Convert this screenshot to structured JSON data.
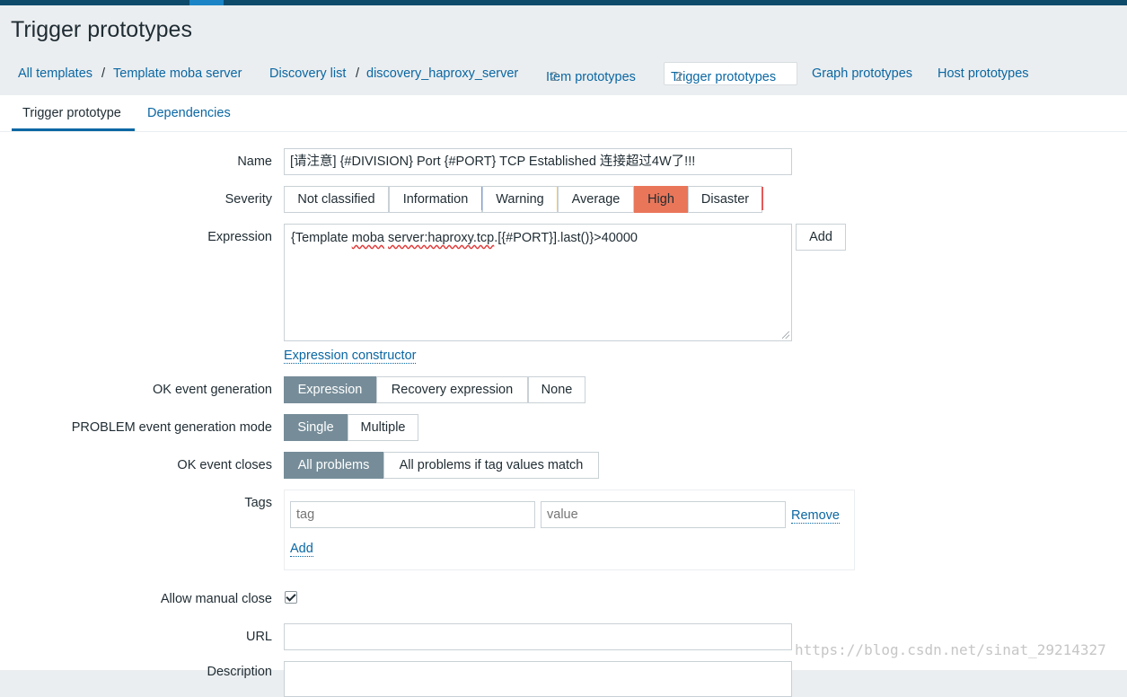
{
  "page": {
    "title": "Trigger prototypes"
  },
  "breadcrumbs": {
    "all_templates": "All templates",
    "template": "Template moba server",
    "discovery_list": "Discovery list",
    "discovery_rule": "discovery_haproxy_server",
    "item_prototypes": "Item prototypes",
    "item_prototypes_count": "2",
    "trigger_prototypes": "Trigger prototypes",
    "trigger_prototypes_count": "2",
    "graph_prototypes": "Graph prototypes",
    "host_prototypes": "Host prototypes"
  },
  "tabs": {
    "trigger_prototype": "Trigger prototype",
    "dependencies": "Dependencies"
  },
  "form": {
    "name_label": "Name",
    "name_value": "[请注意] {#DIVISION} Port {#PORT} TCP Established 连接超过4W了!!!",
    "severity_label": "Severity",
    "severity_options": [
      "Not classified",
      "Information",
      "Warning",
      "Average",
      "High",
      "Disaster"
    ],
    "severity_selected": "High",
    "severity_colors": {
      "not_classified": "#97AAB3",
      "information": "#7499FF",
      "warning": "#FFC859",
      "average": "#FFA059",
      "high": "#E97659",
      "disaster": "#E45959"
    },
    "expression_label": "Expression",
    "expression_part1": "{Template ",
    "expression_part2": "moba",
    "expression_part3": " ",
    "expression_part4": "server:haproxy.tcp",
    "expression_part5": ".[{#PORT}].last()}>40000",
    "expression_add": "Add",
    "expression_constructor": "Expression constructor",
    "ok_event_generation_label": "OK event generation",
    "ok_event_generation_options": [
      "Expression",
      "Recovery expression",
      "None"
    ],
    "ok_event_generation_selected": "Expression",
    "problem_mode_label": "PROBLEM event generation mode",
    "problem_mode_options": [
      "Single",
      "Multiple"
    ],
    "problem_mode_selected": "Single",
    "ok_event_closes_label": "OK event closes",
    "ok_event_closes_options": [
      "All problems",
      "All problems if tag values match"
    ],
    "ok_event_closes_selected": "All problems",
    "tags_label": "Tags",
    "tag_placeholder": "tag",
    "value_placeholder": "value",
    "tag_remove": "Remove",
    "tag_add": "Add",
    "allow_manual_close_label": "Allow manual close",
    "allow_manual_close_checked": true,
    "url_label": "URL",
    "url_value": "",
    "description_label": "Description"
  },
  "watermark": "https://blog.csdn.net/sinat_29214327"
}
